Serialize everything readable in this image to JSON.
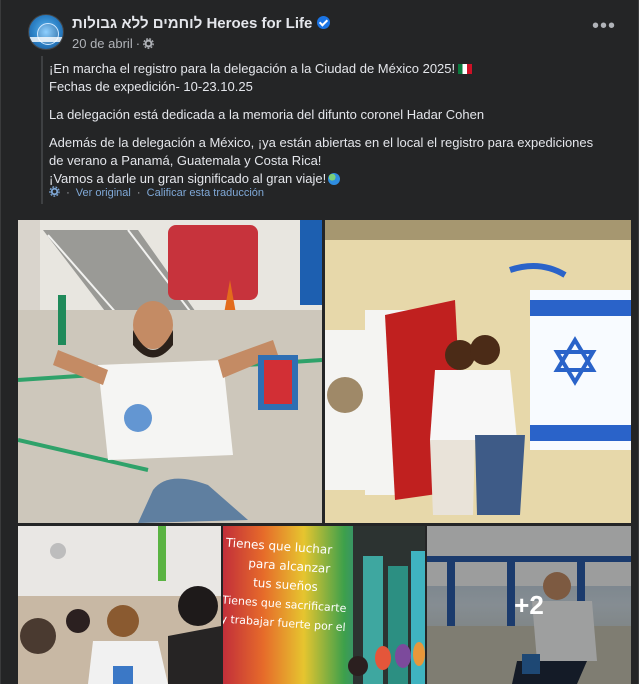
{
  "post": {
    "page_name": "לוחמים ללא גבולות Heroes for Life",
    "date": "20 de abril",
    "paragraphs": [
      "¡En marcha el registro para la delegación a la Ciudad de México 2025!",
      "Fechas de expedición- 10-23.10.25",
      "La delegación está dedicada a la memoria del difunto coronel Hadar Cohen",
      "Además de la delegación a México, ¡ya están abiertas en el local el registro para expediciones de verano a Panamá, Guatemala y Costa Rica!",
      "¡Vamos a darle un gran significado al gran viaje!"
    ],
    "translation": {
      "see_original": "Ver original",
      "rate": "Calificar esta traducción",
      "separator": "·"
    },
    "more_photos_label": "+2"
  },
  "icons": {
    "verified": "verified-badge-icon",
    "privacy": "gear-icon",
    "more": "more-options-icon",
    "translate": "translate-gear-icon"
  },
  "colors": {
    "background": "#242526",
    "text_primary": "#e4e6eb",
    "text_secondary": "#b0b3b8",
    "link": "#7fa8d6",
    "verified": "#1b74e4"
  },
  "photo_text": {
    "mural_line1": "Tienes que luchar",
    "mural_line2": "para alcanzar",
    "mural_line3": "tus sueños",
    "mural_line4": "Tienes que sacrificarte",
    "mural_line5": "y trabajar fuerte por el"
  }
}
